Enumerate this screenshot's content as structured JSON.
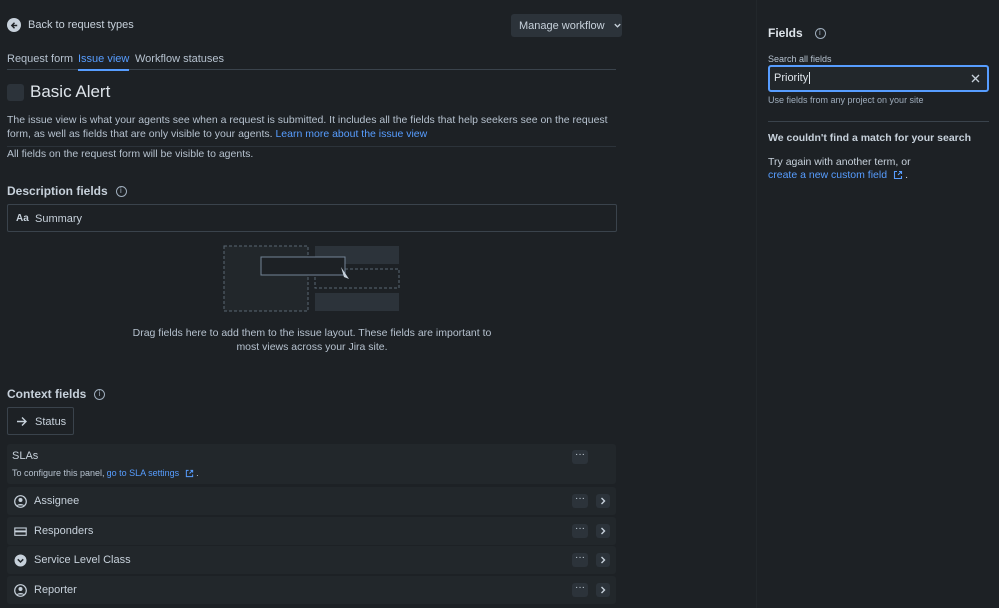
{
  "header": {
    "back_label": "Back to request types",
    "manage_workflow_label": "Manage workflow"
  },
  "tabs": [
    {
      "label": "Request form",
      "active": false
    },
    {
      "label": "Issue view",
      "active": true
    },
    {
      "label": "Workflow statuses",
      "active": false
    }
  ],
  "title": "Basic Alert",
  "description": {
    "text": "The issue view is what your agents see when a request is submitted. It includes all the fields that help seekers see on the request form, as well as fields that are only visible to your agents.",
    "link": "Learn more about the issue view",
    "note": "All fields on the request form will be visible to agents."
  },
  "description_fields": {
    "heading": "Description fields",
    "items": [
      {
        "label": "Summary",
        "icon": "Aa"
      }
    ],
    "drop_text": "Drag fields here to add them to the issue layout. These fields are important to most views across your Jira site."
  },
  "context_fields": {
    "heading": "Context fields",
    "status_label": "Status",
    "slas": {
      "label": "SLAs",
      "note": "To configure this panel,",
      "link": "go to SLA settings"
    },
    "items": [
      {
        "label": "Assignee",
        "icon": "user-icon"
      },
      {
        "label": "Responders",
        "icon": "team-icon"
      },
      {
        "label": "Service Level Class",
        "icon": "chevron-circle-icon"
      },
      {
        "label": "Reporter",
        "icon": "user-icon"
      }
    ]
  },
  "sidebar": {
    "title": "Fields",
    "search_label": "Search all fields",
    "search_value": "Priority",
    "search_hint": "Use fields from any project on your site",
    "no_match_heading": "We couldn't find a match for your search",
    "try_again": "Try again with another term, or",
    "create_link": "create a new custom field",
    "period": "."
  },
  "colors": {
    "accent": "#579dff",
    "background": "#1d2125",
    "surface": "#22272b"
  }
}
